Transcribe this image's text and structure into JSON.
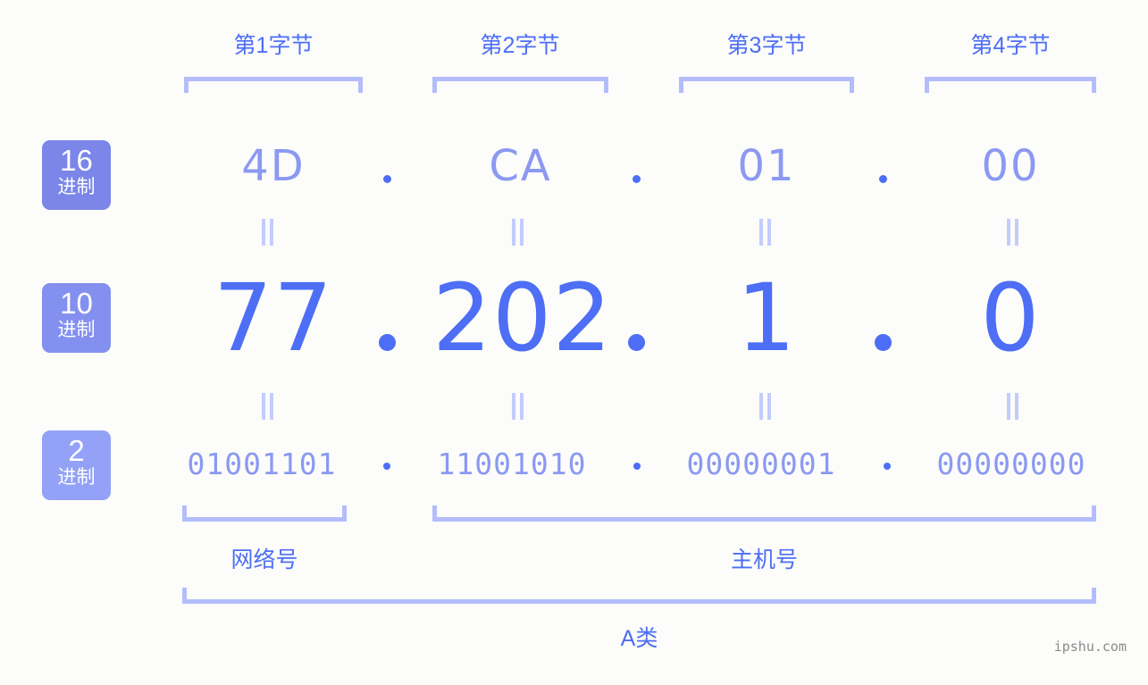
{
  "meta": {
    "watermark": "ipshu.com",
    "accent_strong": "#4d6ef5",
    "accent_mid": "#8b99f2",
    "accent_light": "#b3bdfb",
    "background": "#fcfdfa"
  },
  "byte_headers": [
    {
      "label": "第1字节"
    },
    {
      "label": "第2字节"
    },
    {
      "label": "第3字节"
    },
    {
      "label": "第4字节"
    }
  ],
  "rows": {
    "hex": {
      "badge_number": "16",
      "badge_suffix": "进制",
      "badge_color": "#7b86e8",
      "values": [
        "4D",
        "CA",
        "01",
        "00"
      ]
    },
    "decimal": {
      "badge_number": "10",
      "badge_suffix": "进制",
      "badge_color": "#8490ef",
      "values": [
        "77",
        "202",
        "1",
        "0"
      ]
    },
    "binary": {
      "badge_number": "2",
      "badge_suffix": "进制",
      "badge_color": "#93a1f7",
      "values": [
        "01001101",
        "11001010",
        "00000001",
        "00000000"
      ]
    }
  },
  "separator": ".",
  "equality_marks": "॥",
  "sections": {
    "network": {
      "label": "网络号"
    },
    "host": {
      "label": "主机号"
    },
    "class": {
      "label": "A类"
    }
  },
  "ip": {
    "dotted_decimal": "77.202.1.0",
    "dotted_hex": "4D.CA.01.00",
    "class": "A"
  }
}
